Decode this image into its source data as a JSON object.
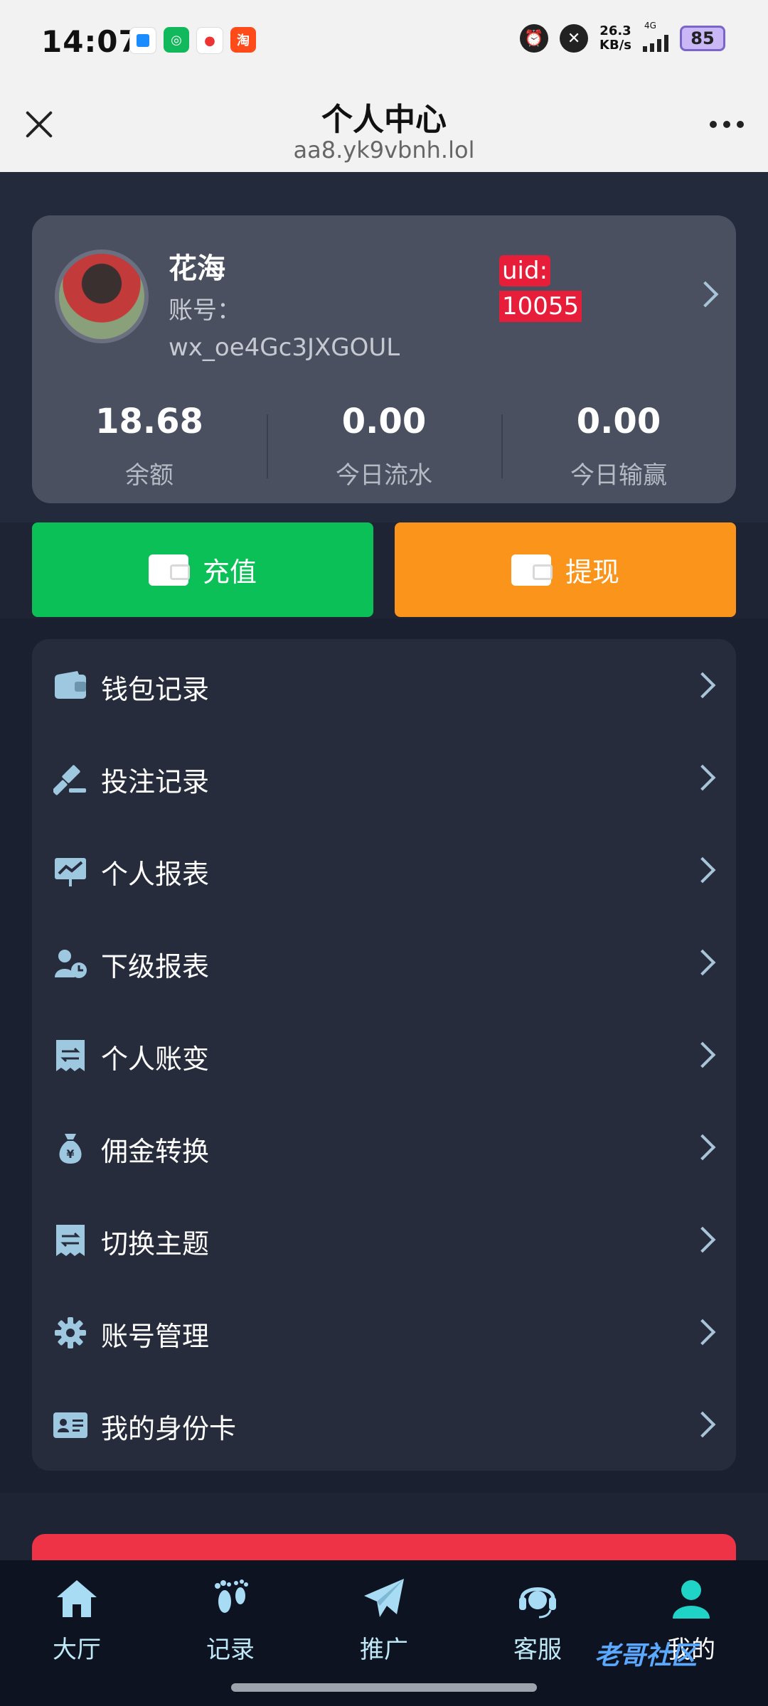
{
  "status_bar": {
    "time": "14:07",
    "net_speed": "26.3",
    "net_unit": "KB/s",
    "network": "4G",
    "battery": "85"
  },
  "titlebar": {
    "title": "个人中心",
    "url": "aa8.yk9vbnh.lol"
  },
  "profile": {
    "name": "花海",
    "account_label": "账号：",
    "account_value": "wx_oe4Gc3JXGOUL",
    "uid_label": "uid:",
    "uid_value": "10055",
    "stats": [
      {
        "value": "18.68",
        "label": "余额"
      },
      {
        "value": "0.00",
        "label": "今日流水"
      },
      {
        "value": "0.00",
        "label": "今日输赢"
      }
    ]
  },
  "actions": {
    "recharge": "充值",
    "withdraw": "提现"
  },
  "menu": [
    {
      "label": "钱包记录",
      "icon": "wallet-icon"
    },
    {
      "label": "投注记录",
      "icon": "gavel-icon"
    },
    {
      "label": "个人报表",
      "icon": "chart-icon"
    },
    {
      "label": "下级报表",
      "icon": "user-clock-icon"
    },
    {
      "label": "个人账变",
      "icon": "receipt-icon"
    },
    {
      "label": "佣金转换",
      "icon": "money-bag-icon"
    },
    {
      "label": "切换主题",
      "icon": "receipt-icon"
    },
    {
      "label": "账号管理",
      "icon": "gear-icon"
    },
    {
      "label": "我的身份卡",
      "icon": "id-card-icon"
    }
  ],
  "bottom_nav": [
    {
      "label": "大厅",
      "icon": "home-icon"
    },
    {
      "label": "记录",
      "icon": "footprints-icon"
    },
    {
      "label": "推广",
      "icon": "paper-plane-icon"
    },
    {
      "label": "客服",
      "icon": "headset-icon"
    },
    {
      "label": "我的",
      "icon": "person-icon"
    }
  ],
  "watermark": "老哥社区",
  "colors": {
    "accent_green": "#0bc157",
    "accent_orange": "#fa941b",
    "uid_red": "#e61e3a",
    "icon_blue": "#9ec8e0",
    "nav_active": "#1fd3c6"
  }
}
